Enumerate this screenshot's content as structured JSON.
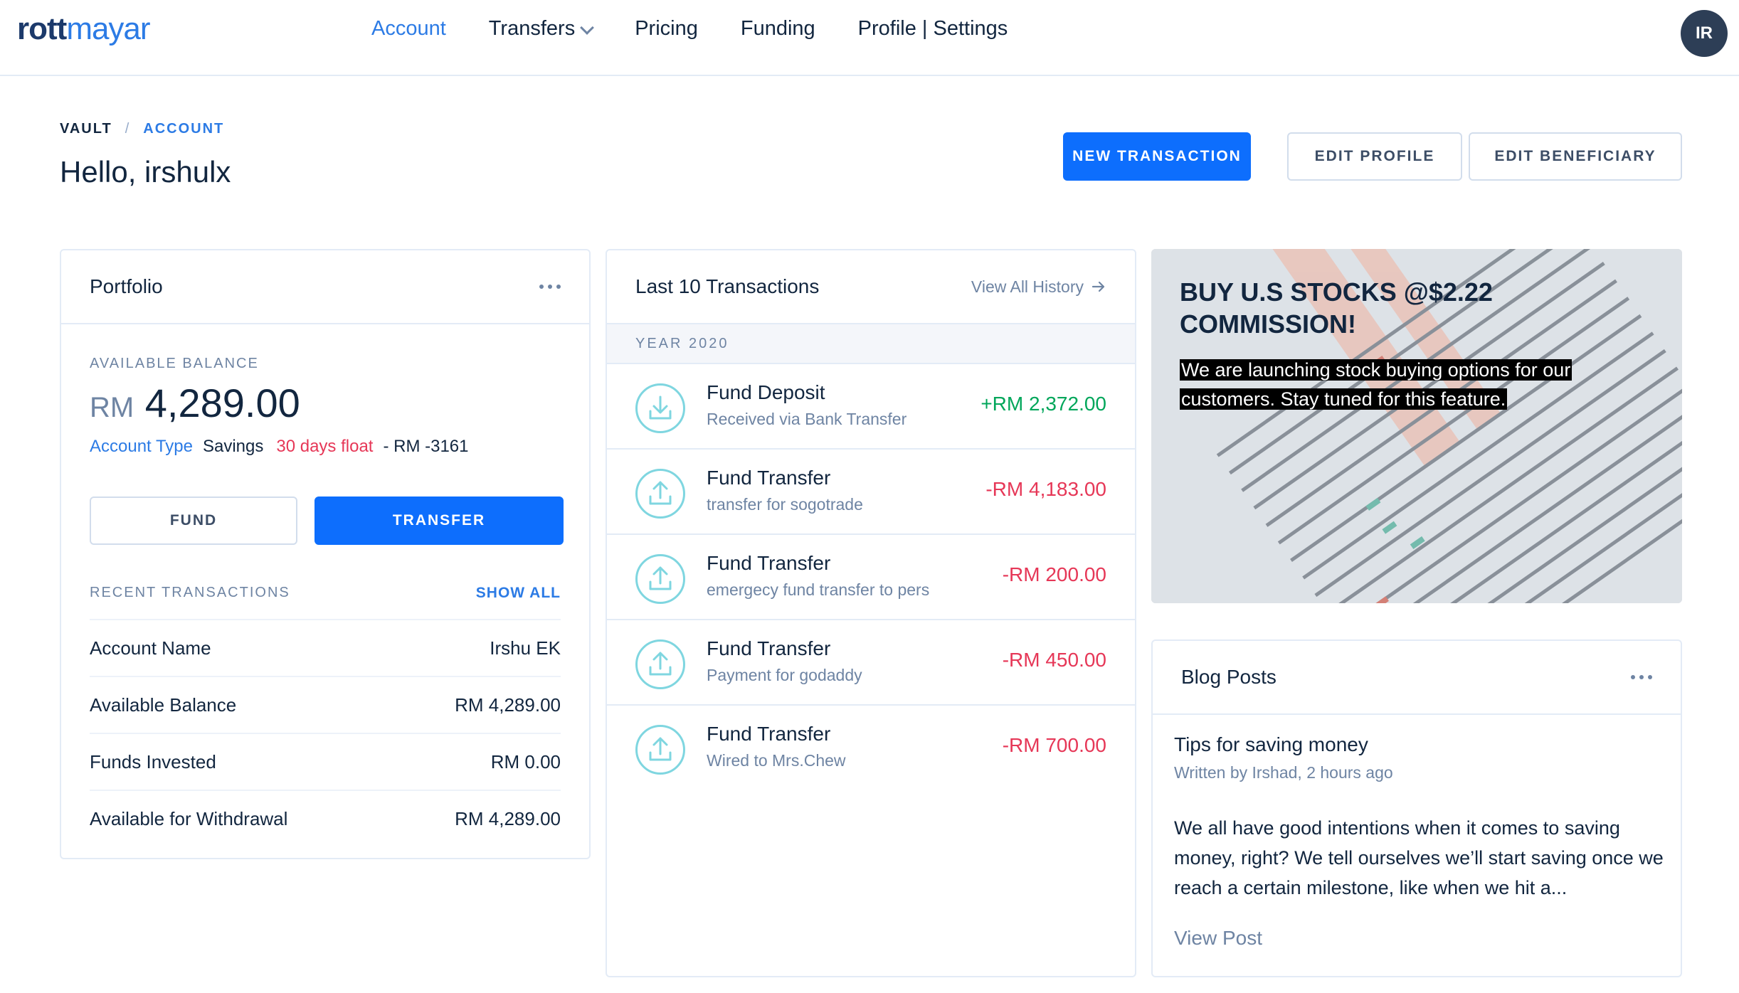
{
  "brand": {
    "logo_bold": "rott",
    "logo_light": "mayar"
  },
  "nav": {
    "items": [
      {
        "label": "Account"
      },
      {
        "label": "Transfers"
      },
      {
        "label": "Pricing"
      },
      {
        "label": "Funding"
      },
      {
        "label": "Profile | Settings"
      }
    ],
    "avatar_initials": "IR"
  },
  "breadcrumb": {
    "item1": "VAULT",
    "separator": "/",
    "item2": "ACCOUNT"
  },
  "greeting": "Hello, irshulx",
  "actions": {
    "new_transaction": "NEW TRANSACTION",
    "edit_profile": "EDIT PROFILE",
    "edit_beneficiary": "EDIT BENEFICIARY"
  },
  "portfolio": {
    "title": "Portfolio",
    "available_balance_label": "AVAILABLE BALANCE",
    "currency": "RM",
    "balance": "4,289.00",
    "account_type_label": "Account Type",
    "account_type_value": "Savings",
    "float_text": "30 days float",
    "account_suffix": "- RM -3161",
    "fund_button": "FUND",
    "transfer_button": "TRANSFER",
    "recent_label": "RECENT TRANSACTIONS",
    "show_all": "SHOW ALL",
    "rows": [
      {
        "label": "Account Name",
        "value": "Irshu EK"
      },
      {
        "label": "Available Balance",
        "value": "RM 4,289.00"
      },
      {
        "label": "Funds Invested",
        "value": "RM 0.00"
      },
      {
        "label": "Available for Withdrawal",
        "value": "RM 4,289.00"
      }
    ]
  },
  "transactions": {
    "title": "Last 10 Transactions",
    "view_all": "View All History",
    "year": "YEAR 2020",
    "items": [
      {
        "title": "Fund Deposit",
        "subtitle": "Received via Bank Transfer",
        "amount": "+RM  2,372.00",
        "kind": "deposit"
      },
      {
        "title": "Fund Transfer",
        "subtitle": "transfer for sogotrade",
        "amount": "-RM  4,183.00",
        "kind": "transfer"
      },
      {
        "title": "Fund Transfer",
        "subtitle": "emergecy fund transfer to pers",
        "amount": "-RM  200.00",
        "kind": "transfer"
      },
      {
        "title": "Fund Transfer",
        "subtitle": "Payment for godaddy",
        "amount": "-RM  450.00",
        "kind": "transfer"
      },
      {
        "title": "Fund Transfer",
        "subtitle": "Wired to Mrs.Chew",
        "amount": "-RM  700.00",
        "kind": "transfer"
      }
    ]
  },
  "promo": {
    "title": "BUY U.S STOCKS @$2.22 COMMISSION!",
    "text_line1": "We are launching stock buying options for our",
    "text_line2": "customers. Stay tuned for this feature."
  },
  "blog": {
    "title": "Blog Posts",
    "post_title": "Tips for saving money",
    "post_meta": "Written by Irshad, 2 hours ago",
    "post_excerpt": "We all have good intentions when it comes to saving money, right? We tell ourselves we’ll start saving once we reach a certain milestone, like when we hit a...",
    "view_post": "View Post"
  },
  "colors": {
    "primary": "#0d6efd",
    "link": "#2c7be5",
    "positive": "#00a65a",
    "negative": "#e63757",
    "dark": "#12263f",
    "muted": "#6e84a3",
    "icon_ring": "#7fd6e0"
  }
}
